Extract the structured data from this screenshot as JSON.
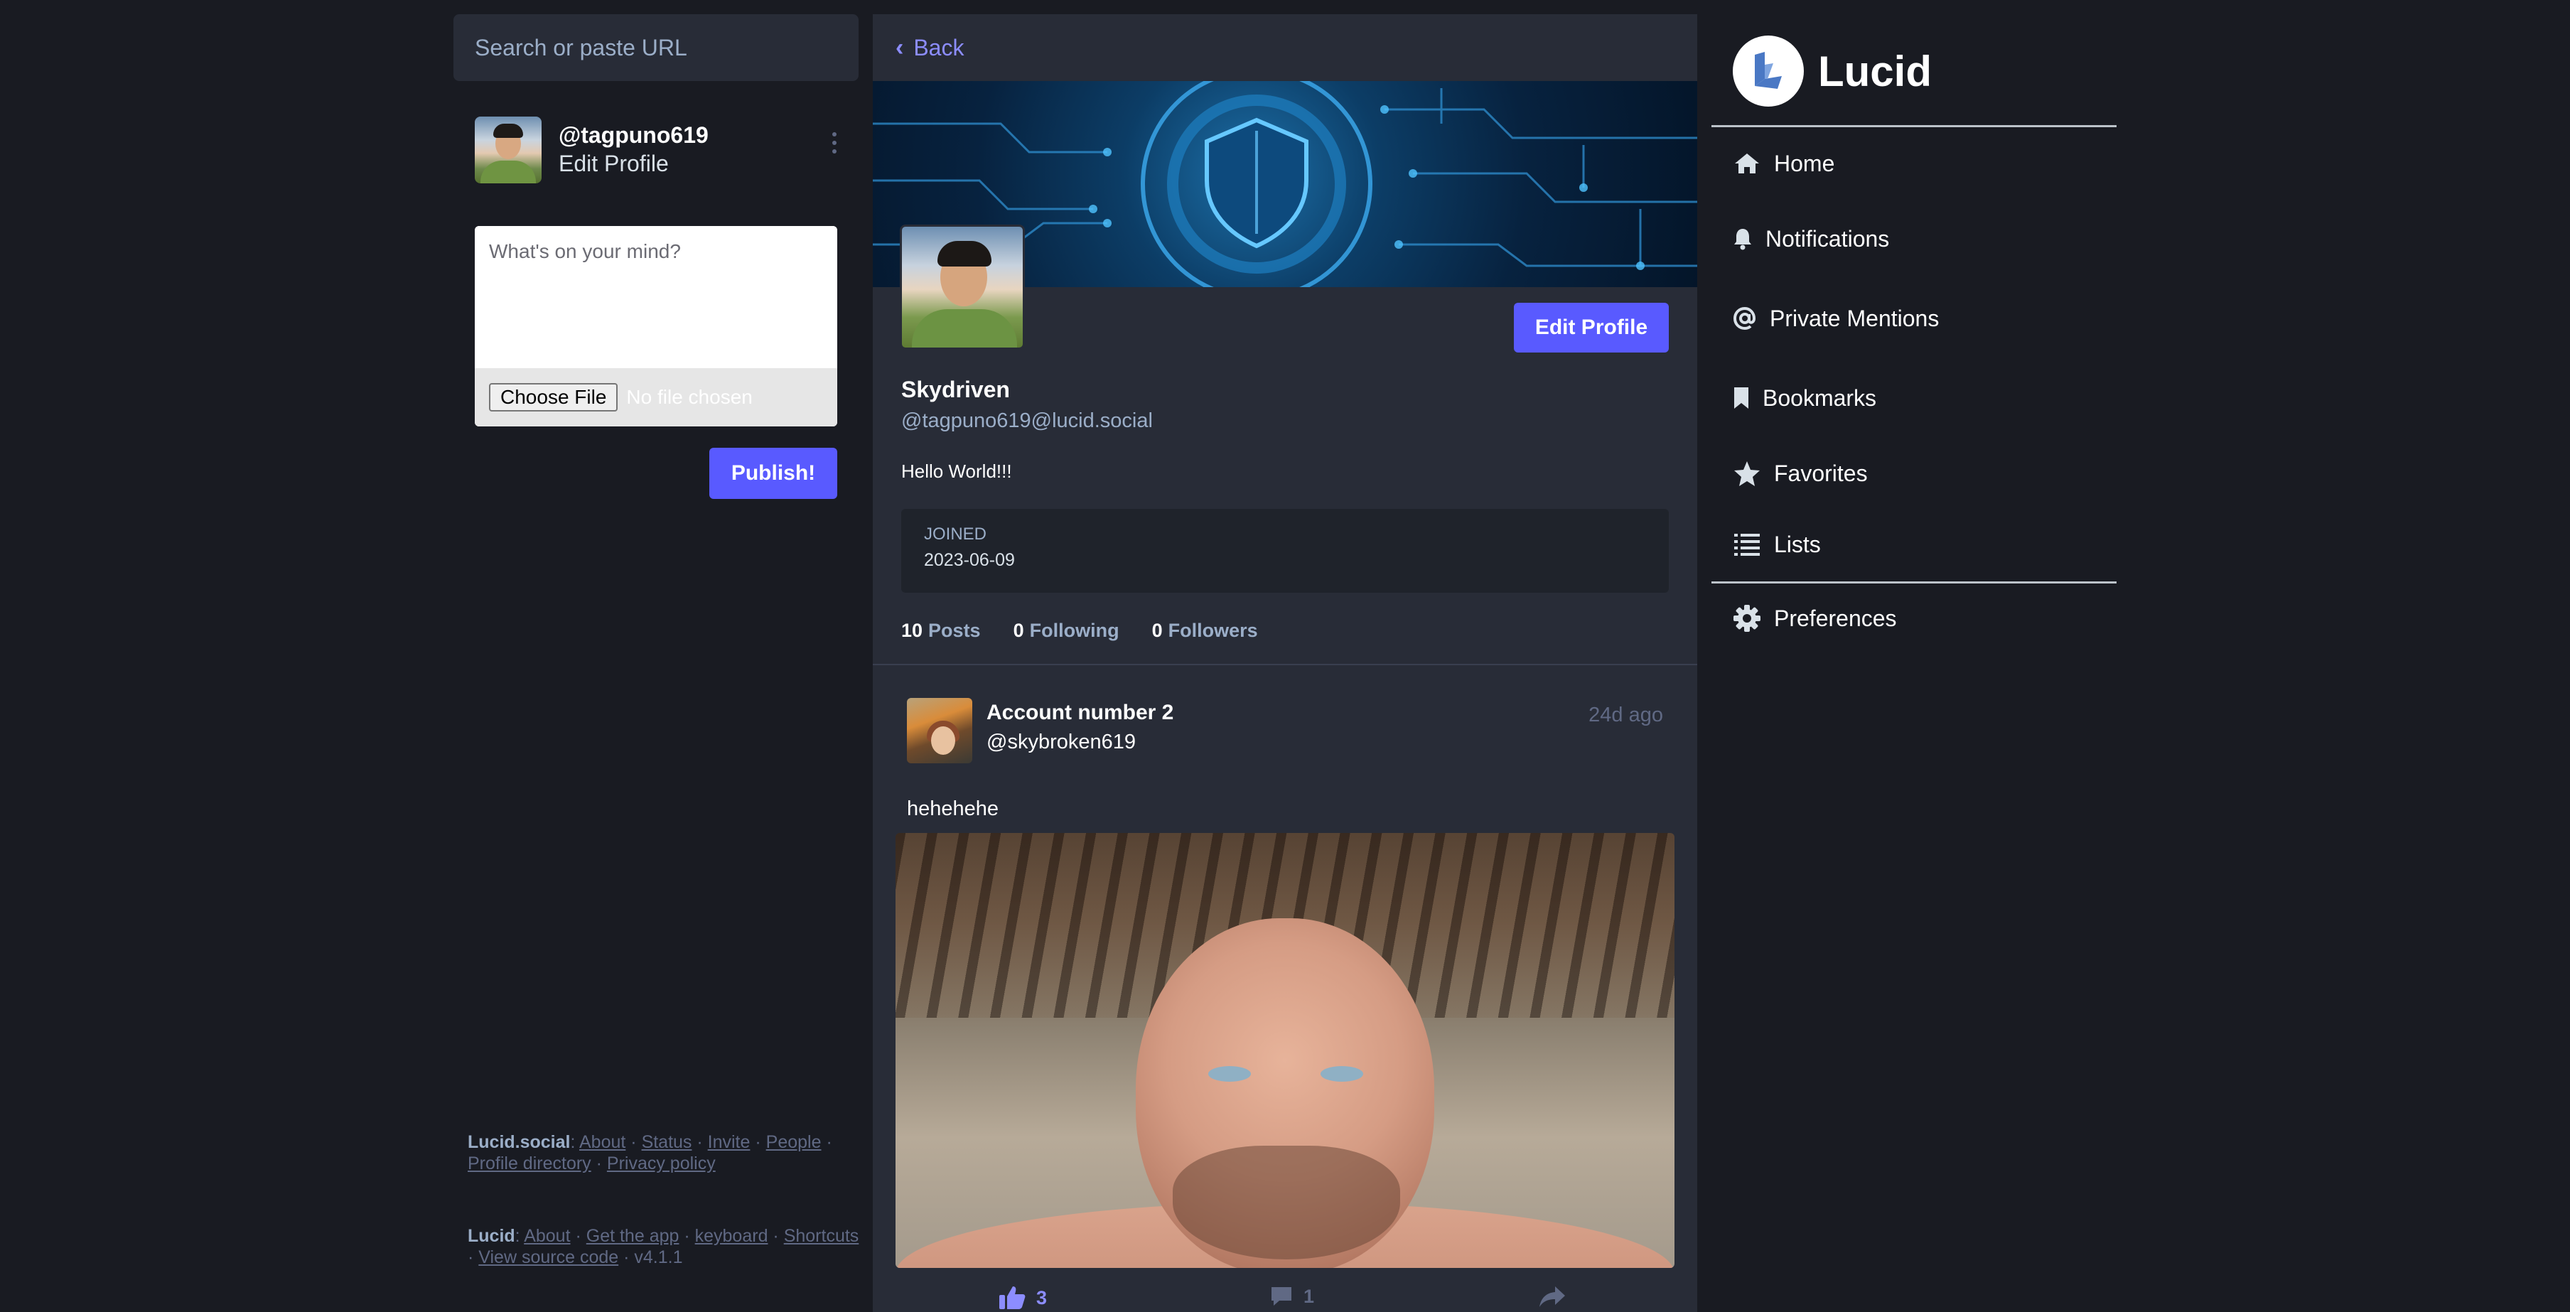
{
  "search": {
    "placeholder": "Search or paste URL"
  },
  "account": {
    "handle": "@tagpuno619",
    "edit_label": "Edit Profile"
  },
  "compose": {
    "placeholder": "What's on your mind?",
    "choose_file": "Choose File",
    "no_file": "No file chosen",
    "publish": "Publish!"
  },
  "footer": {
    "server": {
      "name": "Lucid.social",
      "links": [
        "About",
        "Status",
        "Invite",
        "People",
        "Profile directory",
        "Privacy policy"
      ]
    },
    "app": {
      "name": "Lucid",
      "links": [
        "About",
        "Get the app",
        "keyboard",
        "Shortcuts",
        "View source code"
      ],
      "version": "v4.1.1"
    }
  },
  "profile": {
    "back": "Back",
    "edit_button": "Edit Profile",
    "display_name": "Skydriven",
    "full_handle": "@tagpuno619@lucid.social",
    "bio": "Hello World!!!",
    "joined_label": "JOINED",
    "joined_date": "2023-06-09",
    "counts": [
      {
        "num": "10",
        "label": "Posts"
      },
      {
        "num": "0",
        "label": "Following"
      },
      {
        "num": "0",
        "label": "Followers"
      }
    ]
  },
  "post": {
    "author": "Account number 2",
    "handle": "@skybroken619",
    "time": "24d ago",
    "text": "hehehehe",
    "likes": "3",
    "replies": "1"
  },
  "brand": {
    "name": "Lucid"
  },
  "nav": [
    {
      "label": "Home",
      "icon": "home-icon"
    },
    {
      "label": "Notifications",
      "icon": "bell-icon"
    },
    {
      "label": "Private Mentions",
      "icon": "at-icon"
    },
    {
      "label": "Bookmarks",
      "icon": "bookmark-icon"
    },
    {
      "label": "Favorites",
      "icon": "star-icon"
    },
    {
      "label": "Lists",
      "icon": "list-icon"
    },
    {
      "label": "Preferences",
      "icon": "gear-icon"
    }
  ],
  "colors": {
    "accent": "#595aff",
    "link": "#8c8dff",
    "bg": "#191b22",
    "panel": "#282c37",
    "muted": "#9baec8"
  }
}
